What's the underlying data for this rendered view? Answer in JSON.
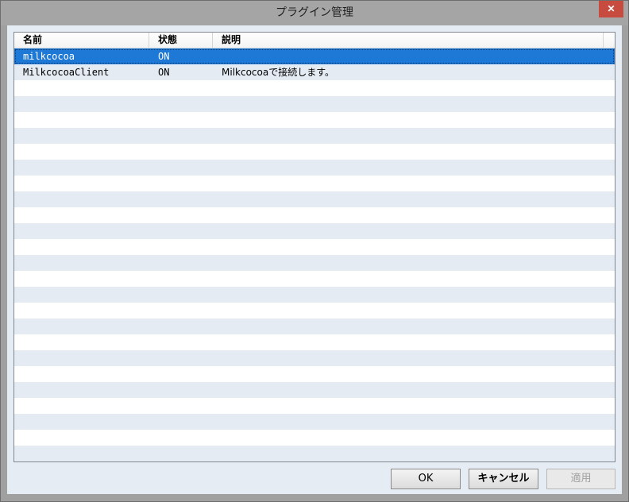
{
  "window": {
    "title": "プラグイン管理",
    "close_label": "✕"
  },
  "table": {
    "columns": [
      "名前",
      "状態",
      "説明"
    ],
    "rows": [
      {
        "name": "milkcocoa",
        "status": "ON",
        "description": ""
      },
      {
        "name": "MilkcocoaClient",
        "status": "ON",
        "description": "Milkcocoaで接続します。"
      }
    ],
    "selected_row": 0
  },
  "buttons": {
    "ok": "OK",
    "cancel": "キャンセル",
    "apply": "適用"
  },
  "colors": {
    "selection": "#1e78d6",
    "stripe": "#e4ebf3",
    "close_button": "#c74b3f"
  }
}
